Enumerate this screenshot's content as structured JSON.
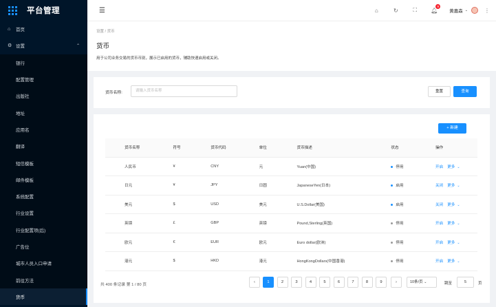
{
  "app": {
    "title": "平台管理"
  },
  "sidebar": {
    "items": [
      {
        "label": "首页",
        "icon": "home-icon"
      },
      {
        "label": "设置",
        "icon": "gear-icon"
      }
    ],
    "sub_items": [
      {
        "label": "银行"
      },
      {
        "label": "配置管理"
      },
      {
        "label": "出版社"
      },
      {
        "label": "地址"
      },
      {
        "label": "应用名"
      },
      {
        "label": "翻译"
      },
      {
        "label": "短信模板"
      },
      {
        "label": "邮件模板"
      },
      {
        "label": "系统配置"
      },
      {
        "label": "行业设置"
      },
      {
        "label": "行业配置项(后)"
      },
      {
        "label": "广告位"
      },
      {
        "label": "城市人员入口申请"
      },
      {
        "label": "前往方法"
      },
      {
        "label": "货币"
      }
    ]
  },
  "header": {
    "notification_count": "9",
    "user_name": "黄嘉森"
  },
  "page": {
    "breadcrumb": "设置 / 货币",
    "title": "货币",
    "description": "用于公司业务交易的货币币别，展示已启用的货币，辅助快速启用或关闭。"
  },
  "filter": {
    "label": "货币名称:",
    "placeholder": "请输入货币名称",
    "reset_label": "重置",
    "query_label": "查询"
  },
  "table": {
    "new_label": "+ 新建",
    "columns": [
      "货币名称",
      "符号",
      "货币代码",
      "单位",
      "货币描述",
      "状态",
      "操作"
    ],
    "rows": [
      {
        "name": "人民币",
        "symbol": "¥",
        "code": "CNY",
        "unit": "元",
        "desc": "Yuan(中国)",
        "status": "停用",
        "status_color": "#1890ff",
        "action": "开启"
      },
      {
        "name": "日元",
        "symbol": "¥",
        "code": "JPY",
        "unit": "日圆",
        "desc": "JapaneseYen(日本)",
        "status": "启用",
        "status_color": "#1890ff",
        "action": "关闭"
      },
      {
        "name": "美元",
        "symbol": "$",
        "code": "USD",
        "unit": "美元",
        "desc": "U.S.Dollar(美国)",
        "status": "启用",
        "status_color": "#1890ff",
        "action": "关闭"
      },
      {
        "name": "英镑",
        "symbol": "£",
        "code": "GBP",
        "unit": "英镑",
        "desc": "Pound,Sterling(英国)",
        "status": "停用",
        "status_color": "#999999",
        "action": "开启"
      },
      {
        "name": "欧元",
        "symbol": "€",
        "code": "EUR",
        "unit": "欧元",
        "desc": "Euro dollar(欧洲)",
        "status": "停用",
        "status_color": "#999999",
        "action": "开启"
      },
      {
        "name": "港元",
        "symbol": "$",
        "code": "HKD",
        "unit": "港元",
        "desc": "HongKongDollars(中国香港)",
        "status": "停用",
        "status_color": "#999999",
        "action": "开启"
      }
    ],
    "more_label": "更多"
  },
  "pagination": {
    "total": "共 400 条记录 第 1 / 80 页",
    "pages": [
      "1",
      "2",
      "3",
      "4",
      "5",
      "6",
      "7",
      "8",
      "9"
    ],
    "current": "1",
    "page_size": "10条/页",
    "jump_label": "跳至",
    "jump_value": "5",
    "page_suffix": "页"
  }
}
